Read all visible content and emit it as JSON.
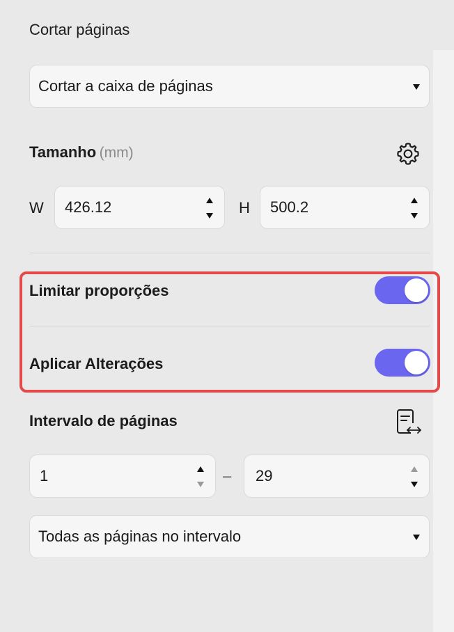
{
  "crop": {
    "title": "Cortar páginas",
    "mode_value": "Cortar a caixa de páginas"
  },
  "size": {
    "title": "Tamanho",
    "unit": "(mm)",
    "icon": "gear-icon",
    "w_label": "W",
    "w_value": "426.12",
    "h_label": "H",
    "h_value": "500.2"
  },
  "options": {
    "limit_proportions": {
      "label": "Limitar proporções",
      "on": true
    },
    "apply_changes": {
      "label": "Aplicar Alterações",
      "on": true
    }
  },
  "range": {
    "title": "Intervalo de páginas",
    "icon": "page-range-swap-icon",
    "from_value": "1",
    "separator": "–",
    "to_value": "29",
    "scope_value": "Todas as páginas no intervalo"
  },
  "colors": {
    "toggle_on": "#6b66f0",
    "highlight": "#e34a4a",
    "background": "#e9e9e9"
  }
}
